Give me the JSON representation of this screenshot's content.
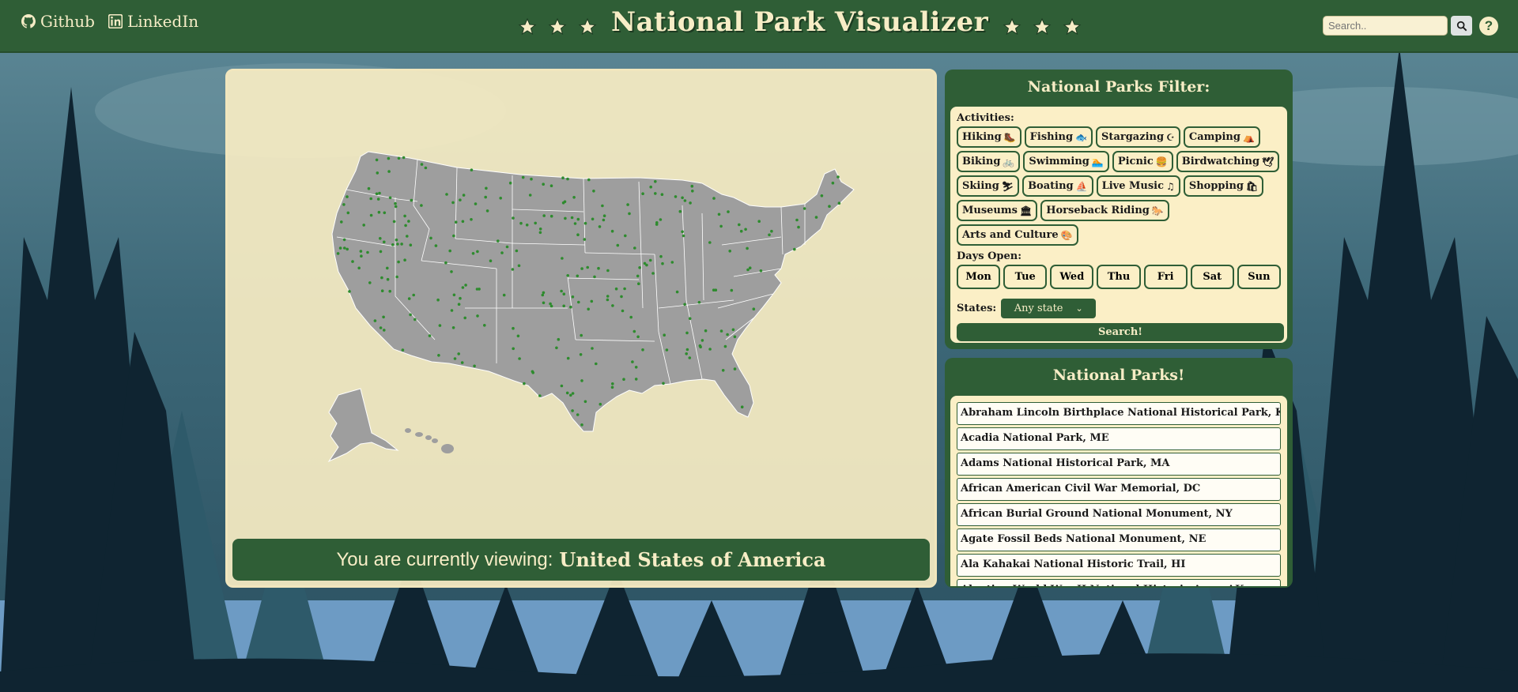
{
  "header": {
    "github_label": "Github",
    "linkedin_label": "LinkedIn",
    "title": "National Park Visualizer",
    "search_placeholder": "Search..",
    "help_label": "?"
  },
  "map": {
    "viewing_prefix": "You are currently viewing:",
    "viewing_region": "United States of America"
  },
  "filter": {
    "title": "National Parks Filter:",
    "activities_label": "Activities:",
    "activities": [
      {
        "label": "Hiking",
        "icon": "🥾"
      },
      {
        "label": "Fishing",
        "icon": "🐟"
      },
      {
        "label": "Stargazing",
        "icon": "☪"
      },
      {
        "label": "Camping",
        "icon": "⛺"
      },
      {
        "label": "Biking",
        "icon": "🚲"
      },
      {
        "label": "Swimming",
        "icon": "🏊"
      },
      {
        "label": "Picnic",
        "icon": "🍔"
      },
      {
        "label": "Birdwatching",
        "icon": "🕊"
      },
      {
        "label": "Skiing",
        "icon": "⛷"
      },
      {
        "label": "Boating",
        "icon": "⛵"
      },
      {
        "label": "Live Music",
        "icon": "♫"
      },
      {
        "label": "Shopping",
        "icon": "🛍"
      },
      {
        "label": "Museums",
        "icon": "🏛"
      },
      {
        "label": "Horseback Riding",
        "icon": "🐎"
      },
      {
        "label": "Arts and Culture",
        "icon": "🎨"
      }
    ],
    "days_label": "Days Open:",
    "days": [
      "Mon",
      "Tue",
      "Wed",
      "Thu",
      "Fri",
      "Sat",
      "Sun"
    ],
    "states_label": "States:",
    "states_selected": "Any state",
    "search_button": "Search!"
  },
  "parks": {
    "title": "National Parks!",
    "items": [
      "Abraham Lincoln Birthplace National Historical Park, KY",
      "Acadia National Park, ME",
      "Adams National Historical Park, MA",
      "African American Civil War Memorial, DC",
      "African Burial Ground National Monument, NY",
      "Agate Fossil Beds National Monument, NE",
      "Ala Kahakai National Historic Trail, HI",
      "Aleutian World War II National Historic Area, AK"
    ]
  },
  "colors": {
    "primary_green": "#2f5e36",
    "cream": "#f7edc6",
    "park_dot": "#2e8b2e",
    "map_gray": "#9e9e9e"
  }
}
